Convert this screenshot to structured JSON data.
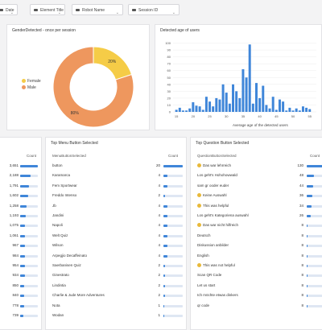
{
  "filters": [
    {
      "label": "Date",
      "icon": "calendar-icon"
    },
    {
      "label": "Element Title",
      "icon": "tag-icon"
    },
    {
      "label": "Robot Name",
      "icon": "tag-icon"
    },
    {
      "label": "Session ID",
      "icon": "tag-icon"
    }
  ],
  "gender": {
    "title": "GenderDetected - once per session",
    "legend": [
      {
        "label": "Female",
        "color": "#f5cc47"
      },
      {
        "label": "Male",
        "color": "#ee975e"
      }
    ],
    "chart_data": {
      "type": "pie",
      "categories": [
        "Female",
        "Male"
      ],
      "values": [
        20,
        80
      ],
      "labels": [
        "20%",
        "80%"
      ]
    }
  },
  "age": {
    "title": "Detected age of users",
    "xlabel": "Average age of the detected users",
    "chart_data": {
      "type": "bar",
      "xlabel": "Average age of the detected users",
      "xticks": [
        "15",
        "20",
        "25",
        "30",
        "35",
        "40",
        "45",
        "50",
        "55"
      ],
      "yticks": [
        "0",
        "10",
        "20",
        "30",
        "40",
        "50",
        "60",
        "70",
        "80",
        "90",
        "100"
      ],
      "ylim": [
        0,
        110
      ],
      "x": [
        15,
        16,
        17,
        18,
        19,
        20,
        21,
        22,
        23,
        24,
        25,
        26,
        27,
        28,
        29,
        30,
        31,
        32,
        33,
        34,
        35,
        36,
        37,
        38,
        39,
        40,
        41,
        42,
        43,
        44,
        45,
        46,
        47,
        48,
        49,
        50,
        51,
        52,
        53,
        54,
        55
      ],
      "values": [
        3,
        6,
        2,
        2,
        5,
        14,
        9,
        8,
        3,
        22,
        15,
        8,
        20,
        18,
        40,
        28,
        12,
        40,
        30,
        20,
        62,
        50,
        98,
        12,
        42,
        20,
        38,
        10,
        5,
        22,
        3,
        18,
        15,
        2,
        6,
        2,
        5,
        2,
        8,
        6,
        4
      ]
    }
  },
  "left_table": {
    "col_count": "Count",
    "values": [
      "3,651",
      "2,188",
      "1,791",
      "1,602",
      "1,258",
      "1,193",
      "1,075",
      "1,061",
      "967",
      "984",
      "954",
      "934",
      "850",
      "840",
      "778",
      "739"
    ]
  },
  "menu": {
    "title": "Top Menu Button Selected",
    "col_label": "MenuButtonSelected",
    "col_count": "Count",
    "rows": [
      {
        "label": "button",
        "value": "20"
      },
      {
        "label": "Karamarca",
        "value": "4"
      },
      {
        "label": "Fem Sportwear",
        "value": "4"
      },
      {
        "label": "Freddo Intenso",
        "value": "2"
      },
      {
        "label": "Jb",
        "value": "4"
      },
      {
        "label": "Jandini",
        "value": "4"
      },
      {
        "label": "Napoli",
        "value": "4"
      },
      {
        "label": "Welt Quiz",
        "value": "4"
      },
      {
        "label": "Wilson",
        "value": "4"
      },
      {
        "label": "Arpegjio Decaffeinato",
        "value": "4"
      },
      {
        "label": "Saerbanisen Quiz",
        "value": "2"
      },
      {
        "label": "Ginestrato",
        "value": "2"
      },
      {
        "label": "Lindintia",
        "value": "2"
      },
      {
        "label": "Charlie & Jude More Adventures",
        "value": "2"
      },
      {
        "label": "Nota",
        "value": "1"
      },
      {
        "label": "Wodan",
        "value": "1"
      }
    ]
  },
  "question": {
    "title": "Top Question Button Selected",
    "col_label": "QuestionButtonSelected",
    "col_count": "Count",
    "rows": [
      {
        "label": "Das war lehrreich",
        "value": "130",
        "icon": true
      },
      {
        "label": "Los geht's Hohohowwald",
        "value": "48",
        "icon": false
      },
      {
        "label": "sam gr ooder euder",
        "value": "44",
        "icon": false
      },
      {
        "label": "Keine Auswahl",
        "value": "36",
        "icon": true
      },
      {
        "label": "This was helpful",
        "value": "34",
        "icon": true
      },
      {
        "label": "Los geht's Kategoriena auswahl",
        "value": "26",
        "icon": false
      },
      {
        "label": "Das war nicht hilfreich",
        "value": "8",
        "icon": true
      },
      {
        "label": "Deutsch",
        "value": "8",
        "icon": false
      },
      {
        "label": "Diskussion anbilder",
        "value": "8",
        "icon": false
      },
      {
        "label": "English",
        "value": "8",
        "icon": false
      },
      {
        "label": "This was not helpful",
        "value": "8",
        "icon": true
      },
      {
        "label": "Scan QR Code",
        "value": "8",
        "icon": false
      },
      {
        "label": "Let us start",
        "value": "8",
        "icon": false
      },
      {
        "label": "Ich möchte etwas dinkers",
        "value": "8",
        "icon": false
      },
      {
        "label": "qr code",
        "value": "8",
        "icon": false
      }
    ]
  },
  "colors": {
    "bar": "#3f86d9",
    "female": "#f5cc47",
    "male": "#ee975e"
  }
}
